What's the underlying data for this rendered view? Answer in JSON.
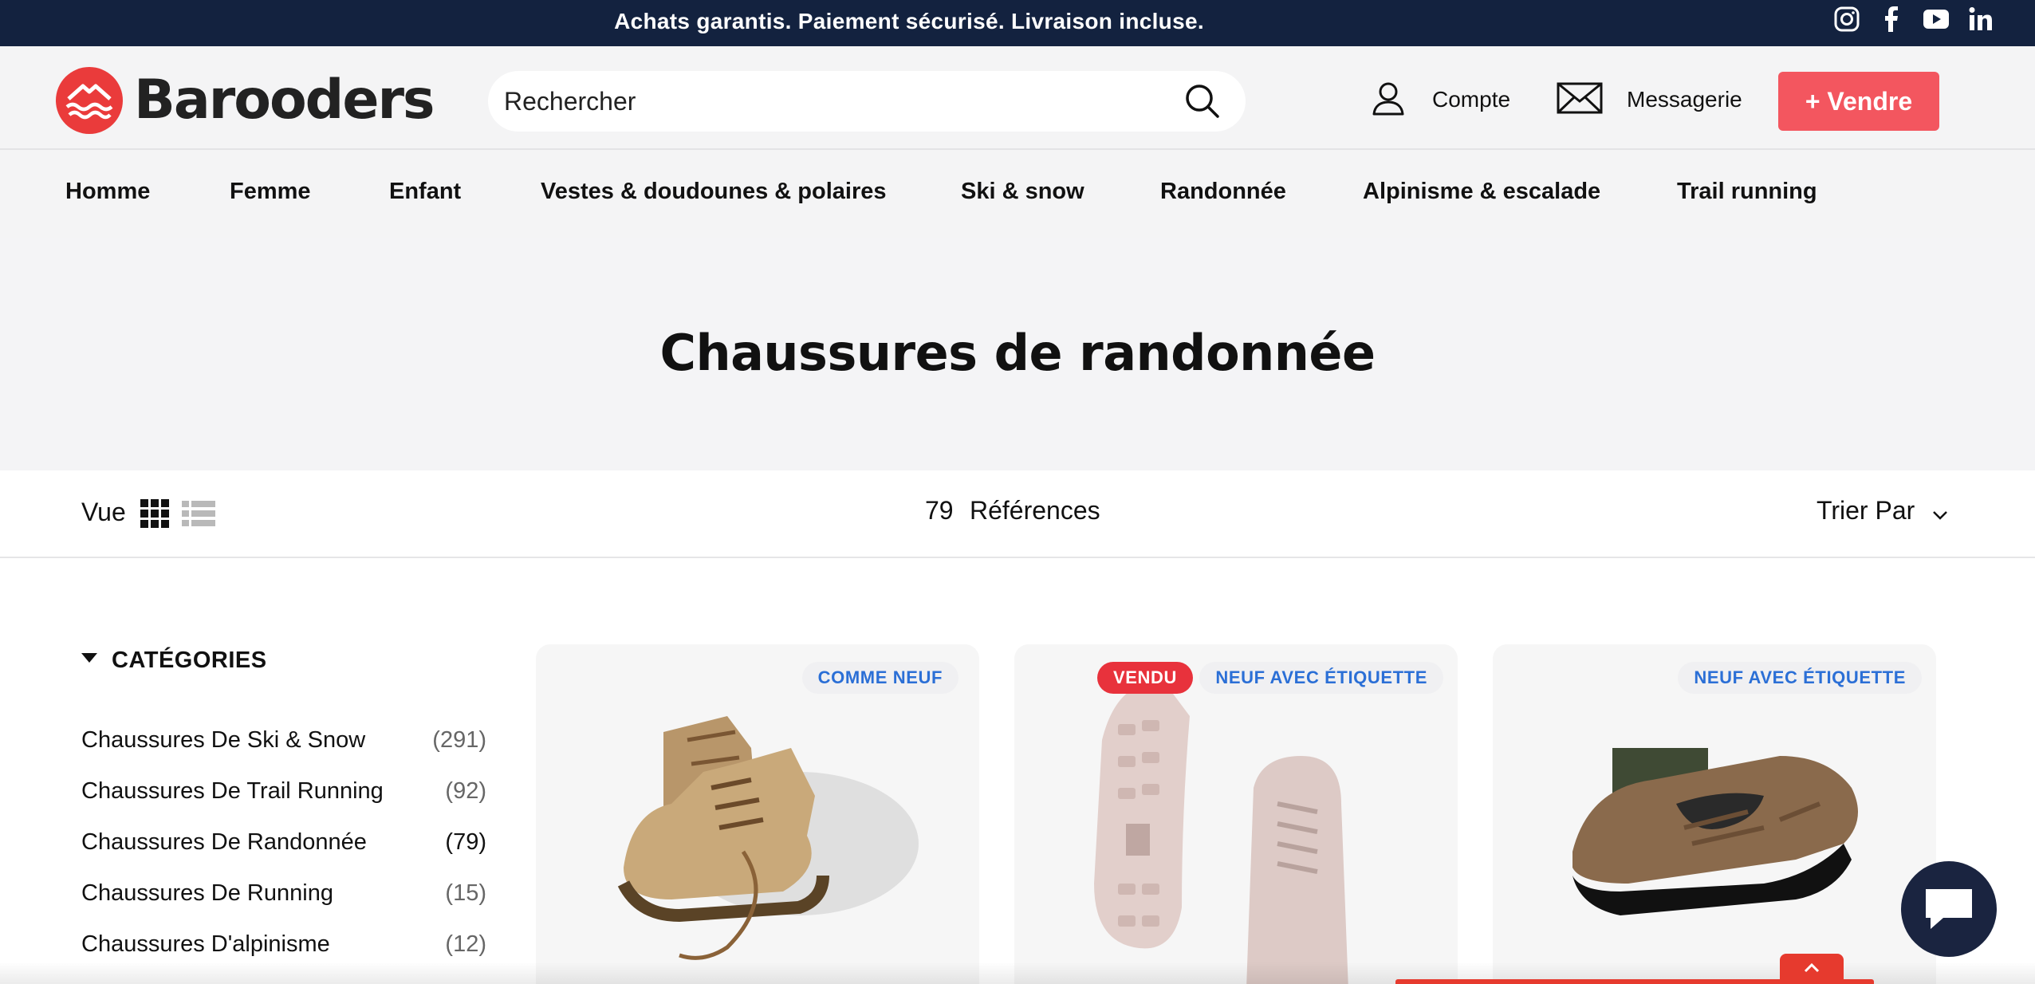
{
  "announcement": {
    "text": "Achats garantis. Paiement sécurisé. Livraison incluse.",
    "social_icons": [
      "instagram-icon",
      "facebook-icon",
      "youtube-icon",
      "linkedin-icon"
    ]
  },
  "header": {
    "brand": "Barooders",
    "search_placeholder": "Rechercher",
    "account_label": "Compte",
    "messages_label": "Messagerie",
    "sell_label": "+ Vendre"
  },
  "nav": {
    "items": [
      {
        "label": "Homme"
      },
      {
        "label": "Femme"
      },
      {
        "label": "Enfant"
      },
      {
        "label": "Vestes & doudounes & polaires"
      },
      {
        "label": "Ski & snow"
      },
      {
        "label": "Randonnée"
      },
      {
        "label": "Alpinisme & escalade"
      },
      {
        "label": "Trail running"
      }
    ]
  },
  "page": {
    "title": "Chaussures de randonnée"
  },
  "toolbar": {
    "view_label": "Vue",
    "ref_count": "79",
    "ref_label": "Références",
    "sort_label": "Trier Par"
  },
  "sidebar": {
    "title": "CATÉGORIES",
    "items": [
      {
        "name": "Chaussures De Ski & Snow",
        "count": "(291)"
      },
      {
        "name": "Chaussures De Trail Running",
        "count": "(92)"
      },
      {
        "name": "Chaussures De Randonnée",
        "count": "(79)"
      },
      {
        "name": "Chaussures De Running",
        "count": "(15)"
      },
      {
        "name": "Chaussures D'alpinisme",
        "count": "(12)"
      }
    ]
  },
  "products": [
    {
      "condition": "COMME NEUF"
    },
    {
      "status": "VENDU",
      "condition": "NEUF AVEC ÉTIQUETTE"
    },
    {
      "condition": "NEUF AVEC ÉTIQUETTE"
    }
  ],
  "colors": {
    "announcement_bg": "#13223f",
    "accent": "#f3565f",
    "badge_text": "#2b6fd6",
    "sold_badge": "#e8323c",
    "chat_bg": "#1a2440"
  }
}
